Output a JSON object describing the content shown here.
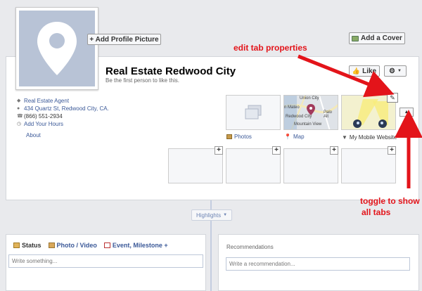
{
  "page": {
    "name": "Real Estate Redwood City",
    "like_prompt": "Be the first person to like this."
  },
  "buttons": {
    "add_profile_picture": "+ Add Profile Picture",
    "add_cover": "Add a Cover",
    "like": "Like"
  },
  "info": {
    "category": "Real Estate Agent",
    "address": "434 Quartz St, Redwood City, CA.",
    "phone": "(866) 551-2934",
    "hours": "Add Your Hours",
    "about": "About"
  },
  "tabs": {
    "photos": "Photos",
    "map": "Map",
    "mobile": "My Mobile Website"
  },
  "map_labels": {
    "union_city": "Union City",
    "san_mateo": "n Mateo",
    "palo_alto": "Palo Alt",
    "redwood_city": "Redwood City",
    "mountain_view": "Mountain View"
  },
  "annotations": {
    "edit_tab": "edit tab properties",
    "toggle_line1": "toggle to show",
    "toggle_line2": "all tabs"
  },
  "timeline": {
    "highlights": "Highlights"
  },
  "composer": {
    "status": "Status",
    "photo_video": "Photo / Video",
    "event": "Event, Milestone +",
    "placeholder": "Write something..."
  },
  "recommendations": {
    "title": "Recommendations",
    "placeholder": "Write a recommendation..."
  },
  "colors": {
    "link": "#3b5998",
    "annotation": "#e3141a",
    "profile_placeholder": "#b8c3d6"
  }
}
